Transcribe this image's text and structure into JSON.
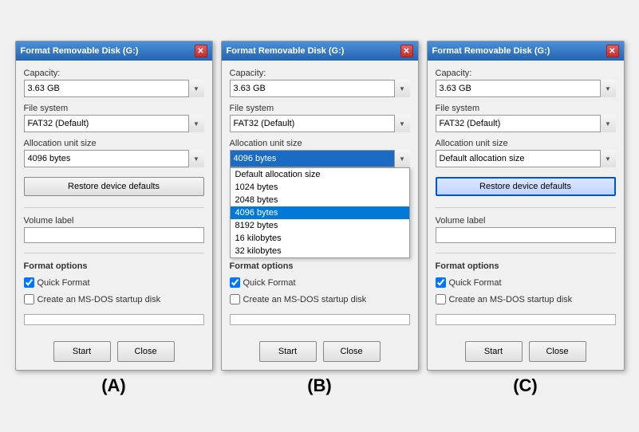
{
  "dialogs": [
    {
      "id": "A",
      "title": "Format Removable Disk (G:)",
      "capacity_label": "Capacity:",
      "capacity_value": "3.63 GB",
      "filesystem_label": "File system",
      "filesystem_value": "FAT32 (Default)",
      "allocation_label": "Allocation unit size",
      "allocation_value": "4096 bytes",
      "restore_label": "Restore device defaults",
      "volume_label": "Volume label",
      "volume_value": "",
      "format_options_label": "Format options",
      "quick_format_label": "Quick Format",
      "quick_format_checked": true,
      "msdos_label": "Create an MS-DOS startup disk",
      "msdos_checked": false,
      "start_label": "Start",
      "close_label": "Close",
      "show_dropdown": false
    },
    {
      "id": "B",
      "title": "Format Removable Disk (G:)",
      "capacity_label": "Capacity:",
      "capacity_value": "3.63 GB",
      "filesystem_label": "File system",
      "filesystem_value": "FAT32 (Default)",
      "allocation_label": "Allocation unit size",
      "allocation_value": "4096 bytes",
      "restore_label": "Restore device defaults",
      "volume_label": "Volume label",
      "volume_value": "",
      "format_options_label": "Format options",
      "quick_format_label": "Quick Format",
      "quick_format_checked": true,
      "msdos_label": "Create an MS-DOS startup disk",
      "msdos_checked": false,
      "start_label": "Start",
      "close_label": "Close",
      "show_dropdown": true,
      "dropdown_items": [
        {
          "label": "Default allocation size",
          "selected": false
        },
        {
          "label": "1024 bytes",
          "selected": false
        },
        {
          "label": "2048 bytes",
          "selected": false
        },
        {
          "label": "4096 bytes",
          "selected": true
        },
        {
          "label": "8192 bytes",
          "selected": false
        },
        {
          "label": "16 kilobytes",
          "selected": false
        },
        {
          "label": "32 kilobytes",
          "selected": false
        }
      ]
    },
    {
      "id": "C",
      "title": "Format Removable Disk (G:)",
      "capacity_label": "Capacity:",
      "capacity_value": "3.63 GB",
      "filesystem_label": "File system",
      "filesystem_value": "FAT32 (Default)",
      "allocation_label": "Allocation unit size",
      "allocation_value": "Default allocation size",
      "restore_label": "Restore device defaults",
      "restore_active": true,
      "volume_label": "Volume label",
      "volume_value": "",
      "format_options_label": "Format options",
      "quick_format_label": "Quick Format",
      "quick_format_checked": true,
      "msdos_label": "Create an MS-DOS startup disk",
      "msdos_checked": false,
      "start_label": "Start",
      "close_label": "Close",
      "show_dropdown": false
    }
  ],
  "labels": [
    "(A)",
    "(B)",
    "(C)"
  ]
}
